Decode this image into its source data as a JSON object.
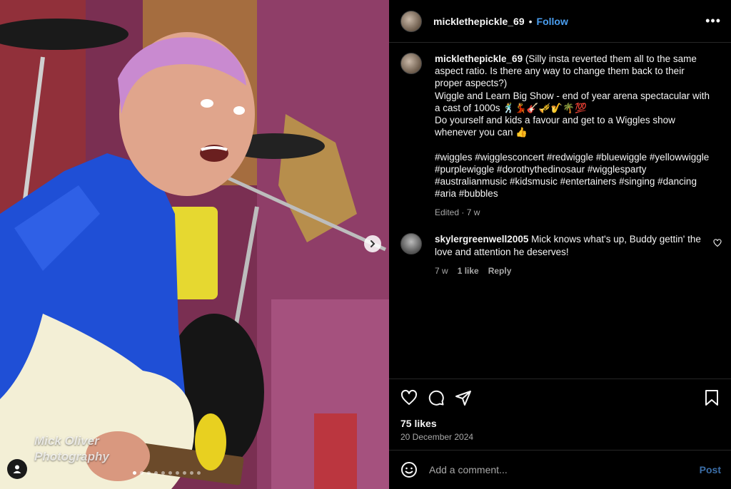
{
  "media": {
    "watermark_line1": "Mick Oliver",
    "watermark_line2": "Photography",
    "next_icon": "chevron-right-icon",
    "tag_icon": "user-tag-icon",
    "carousel_dots": 10,
    "active_dot": 0
  },
  "post": {
    "username": "micklethepickle_69",
    "separator": "•",
    "follow_label": "Follow",
    "more_label": "•••",
    "caption": {
      "username": "micklethepickle_69",
      "text": " (Silly insta reverted them all to the same aspect ratio. Is there any way to change them back to their proper aspects?)\nWiggle and Learn Big Show - end of year arena spectacular with a cast of 1000s 🕺💃🎸🎺🎷🌴💯\nDo yourself and kids a favour and get to a Wiggles show whenever you can 👍\n\n#wiggles #wigglesconcert #redwiggle #bluewiggle #yellowwiggle #purplewiggle #dorothythedinosaur #wigglesparty #australianmusic #kidsmusic #entertainers #singing #dancing #aria #bubbles",
      "meta": "Edited · 7 w"
    },
    "comments": [
      {
        "username": "skylergreenwell2005",
        "text": " Mick knows what's up, Buddy gettin' the love and attention he deserves!",
        "age": "7 w",
        "likes": "1 like",
        "reply": "Reply"
      }
    ],
    "likes": "75 likes",
    "date": "20 December 2024",
    "add_comment_placeholder": "Add a comment...",
    "post_label": "Post"
  },
  "colors": {
    "accent_blue": "#4a9ef0",
    "post_blue": "#3b6ea8",
    "muted": "#a8a8a8",
    "background": "#000000"
  }
}
